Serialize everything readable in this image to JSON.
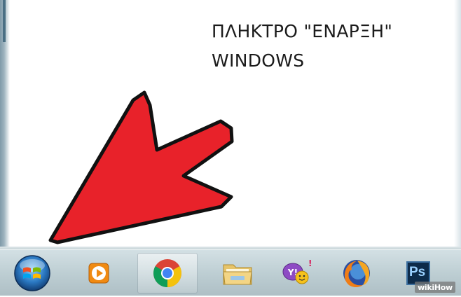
{
  "annotation": {
    "line1": "ΠΛΗΚΤΡΟ \"ΕΝΑΡΞΗ\"",
    "line2": "WINDOWS"
  },
  "colors": {
    "arrow_fill": "#e8222a",
    "arrow_outline": "#111111",
    "taskbar": "#c4d3d8"
  },
  "taskbar": {
    "start_button": {
      "icon": "windows-start-orb-icon"
    },
    "pinned": [
      {
        "icon": "media-player-icon"
      },
      {
        "icon": "chrome-icon",
        "active": true
      },
      {
        "icon": "file-explorer-folder-icon"
      },
      {
        "icon": "yahoo-messenger-icon"
      },
      {
        "icon": "firefox-icon"
      },
      {
        "icon": "photoshop-icon",
        "label": "Ps"
      }
    ]
  },
  "watermark": {
    "text": "wikiHow"
  }
}
